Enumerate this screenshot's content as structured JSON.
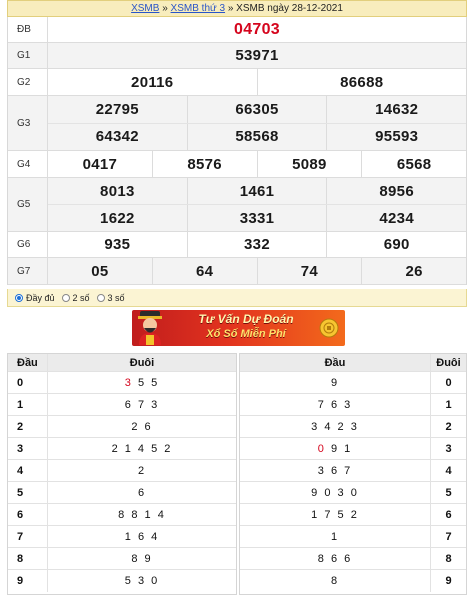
{
  "header": {
    "crumb1": "XSMB",
    "sep1": " » ",
    "crumb2": "XSMB thứ 3",
    "sep2": " » ",
    "title": "XSMB ngày 28-12-2021"
  },
  "prizes": {
    "db": {
      "label": "ĐB",
      "numbers": [
        "04703"
      ]
    },
    "g1": {
      "label": "G1",
      "numbers": [
        "53971"
      ]
    },
    "g2": {
      "label": "G2",
      "numbers": [
        "20116",
        "86688"
      ]
    },
    "g3": {
      "label": "G3",
      "numbers": [
        "22795",
        "66305",
        "14632",
        "64342",
        "58568",
        "95593"
      ]
    },
    "g4": {
      "label": "G4",
      "numbers": [
        "0417",
        "8576",
        "5089",
        "6568"
      ]
    },
    "g5": {
      "label": "G5",
      "numbers": [
        "8013",
        "1461",
        "8956",
        "1622",
        "3331",
        "4234"
      ]
    },
    "g6": {
      "label": "G6",
      "numbers": [
        "935",
        "332",
        "690"
      ]
    },
    "g7": {
      "label": "G7",
      "numbers": [
        "05",
        "64",
        "74",
        "26"
      ]
    }
  },
  "options": {
    "selected": "full",
    "full": "Đầy đủ",
    "two": "2 số",
    "three": "3 số"
  },
  "banner": {
    "line1": "Tư Vấn Dự Đoán",
    "line2": "Xổ Số Miễn Phí",
    "mascot": "god-of-fortune-icon",
    "coin": "gold-coin-icon"
  },
  "loto_head": {
    "col_head": "Đầu",
    "col_tail": "Đuôi",
    "rows": [
      {
        "head": "0",
        "highlight": "3",
        "rest": "5 5"
      },
      {
        "head": "1",
        "highlight": "",
        "rest": "6 7 3"
      },
      {
        "head": "2",
        "highlight": "",
        "rest": "2 6"
      },
      {
        "head": "3",
        "highlight": "",
        "rest": "2 1 4 5 2"
      },
      {
        "head": "4",
        "highlight": "",
        "rest": "2"
      },
      {
        "head": "5",
        "highlight": "",
        "rest": "6"
      },
      {
        "head": "6",
        "highlight": "",
        "rest": "8 8 1 4"
      },
      {
        "head": "7",
        "highlight": "",
        "rest": "1 6 4"
      },
      {
        "head": "8",
        "highlight": "",
        "rest": "8 9"
      },
      {
        "head": "9",
        "highlight": "",
        "rest": "5 3 0"
      }
    ]
  },
  "loto_tail": {
    "col_head": "Đầu",
    "col_tail": "Đuôi",
    "rows": [
      {
        "tail": "0",
        "highlight": "",
        "rest": "9"
      },
      {
        "tail": "1",
        "highlight": "",
        "rest": "7 6 3"
      },
      {
        "tail": "2",
        "highlight": "",
        "rest": "3 4 2 3"
      },
      {
        "tail": "3",
        "highlight": "0",
        "rest": "9 1"
      },
      {
        "tail": "4",
        "highlight": "",
        "rest": "3 6 7"
      },
      {
        "tail": "5",
        "highlight": "",
        "rest": "9 0 3 0"
      },
      {
        "tail": "6",
        "highlight": "",
        "rest": "1 7 5 2"
      },
      {
        "tail": "7",
        "highlight": "",
        "rest": "1"
      },
      {
        "tail": "8",
        "highlight": "",
        "rest": "8 6 6"
      },
      {
        "tail": "9",
        "highlight": "",
        "rest": "8"
      }
    ]
  },
  "colors": {
    "accent_red": "#d5051d",
    "header_bg": "#f8edbd",
    "link": "#2a55c8"
  }
}
